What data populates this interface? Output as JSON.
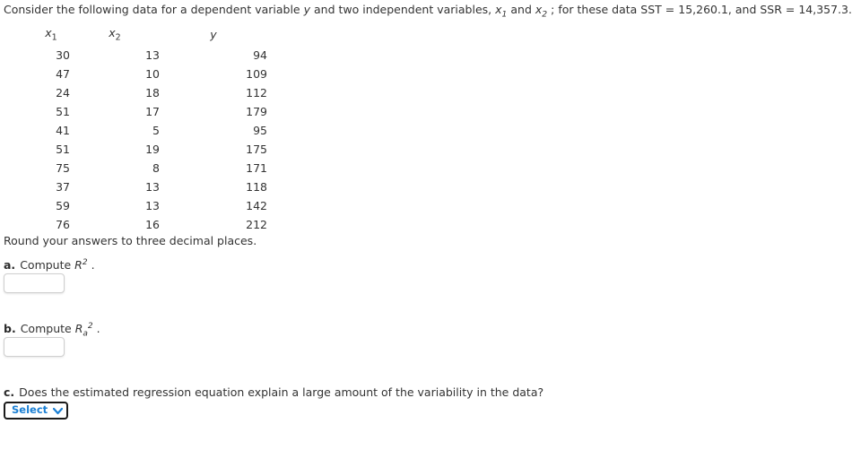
{
  "intro": {
    "part1": "Consider the following data for a dependent variable ",
    "y_var": "y",
    "part2": " and two independent variables, ",
    "x1_var": "x",
    "x1_sub": "1",
    "part3": " and ",
    "x2_var": "x",
    "x2_sub": "2",
    "part4": " ; for these data SST = ",
    "sst_value": "15,260.1",
    "part5": ", and SSR = ",
    "ssr_value": "14,357.3",
    "part6": "."
  },
  "table": {
    "headers": {
      "x1": "x",
      "x1_sub": "1",
      "x2": "x",
      "x2_sub": "2",
      "y": "y"
    },
    "rows": [
      {
        "x1": "30",
        "x2": "13",
        "y": "94"
      },
      {
        "x1": "47",
        "x2": "10",
        "y": "109"
      },
      {
        "x1": "24",
        "x2": "18",
        "y": "112"
      },
      {
        "x1": "51",
        "x2": "17",
        "y": "179"
      },
      {
        "x1": "41",
        "x2": "5",
        "y": "95"
      },
      {
        "x1": "51",
        "x2": "19",
        "y": "175"
      },
      {
        "x1": "75",
        "x2": "8",
        "y": "171"
      },
      {
        "x1": "37",
        "x2": "13",
        "y": "118"
      },
      {
        "x1": "59",
        "x2": "13",
        "y": "142"
      },
      {
        "x1": "76",
        "x2": "16",
        "y": "212"
      }
    ]
  },
  "rounding_note": "Round your answers to three decimal places.",
  "questions": {
    "a": {
      "label": "a.",
      "prompt_prefix": "Compute ",
      "symbol": "R",
      "symbol_sup": "2",
      "prompt_suffix": " .",
      "answer_value": "",
      "answer_placeholder": ""
    },
    "b": {
      "label": "b.",
      "prompt_prefix": "Compute ",
      "symbol": "R",
      "symbol_sub": "a",
      "symbol_sup": "2",
      "prompt_suffix": " .",
      "answer_value": "",
      "answer_placeholder": ""
    },
    "c": {
      "label": "c.",
      "text": "Does the estimated regression equation explain a large amount of the variability in the data?",
      "select_label": "Select"
    }
  },
  "colors": {
    "text": "#333333",
    "select_text": "#1a7fd4",
    "select_border": "#1a1a1a",
    "input_border": "#cfcfcf",
    "background": "#ffffff"
  }
}
